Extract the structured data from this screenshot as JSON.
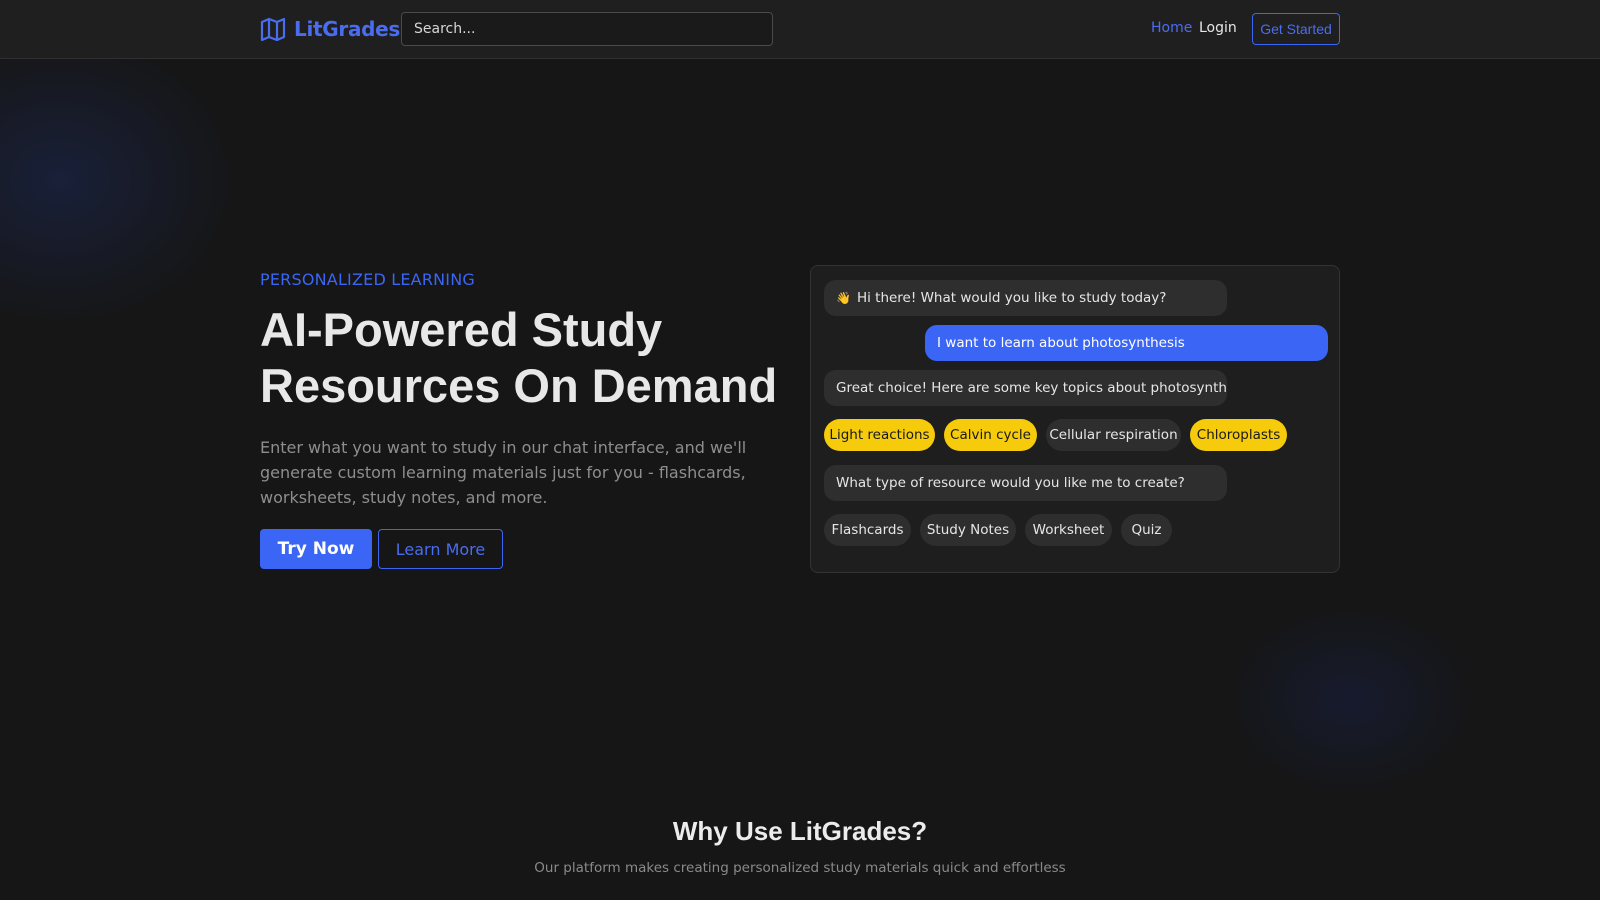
{
  "header": {
    "brand_name": "LitGrades",
    "brand_icon": "open-book-icon",
    "search_placeholder": "Search...",
    "nav": {
      "home": "Home",
      "login": "Login",
      "cta": "Get Started"
    }
  },
  "hero": {
    "eyebrow": "PERSONALIZED LEARNING",
    "title": "AI-Powered Study Resources On Demand",
    "description": "Enter what you want to study in our chat interface, and we'll generate custom learning materials just for you - flashcards, worksheets, study notes, and more.",
    "primary_button": "Try Now",
    "secondary_button": "Learn More"
  },
  "chat": {
    "greeting": {
      "emoji": "👋",
      "text": "Hi there! What would you like to study today?"
    },
    "user_message": "I want to learn about photosynthesis",
    "bot_reply": "Great choice! Here are some key topics about photosynthesis:",
    "topics": [
      {
        "label": "Light reactions",
        "highlighted": true
      },
      {
        "label": "Calvin cycle",
        "highlighted": true
      },
      {
        "label": "Cellular respiration",
        "highlighted": false
      },
      {
        "label": "Chloroplasts",
        "highlighted": true
      }
    ],
    "question": "What type of resource would you like me to create?",
    "resource_options": [
      "Flashcards",
      "Study Notes",
      "Worksheet",
      "Quiz"
    ]
  },
  "why": {
    "title": "Why Use LitGrades?",
    "subtitle": "Our platform makes creating personalized study materials quick and effortless"
  },
  "colors": {
    "background": "#161616",
    "accent": "#3b66f5",
    "highlight_chip": "#f5cb0b",
    "bubble": "#2e2e2e"
  }
}
